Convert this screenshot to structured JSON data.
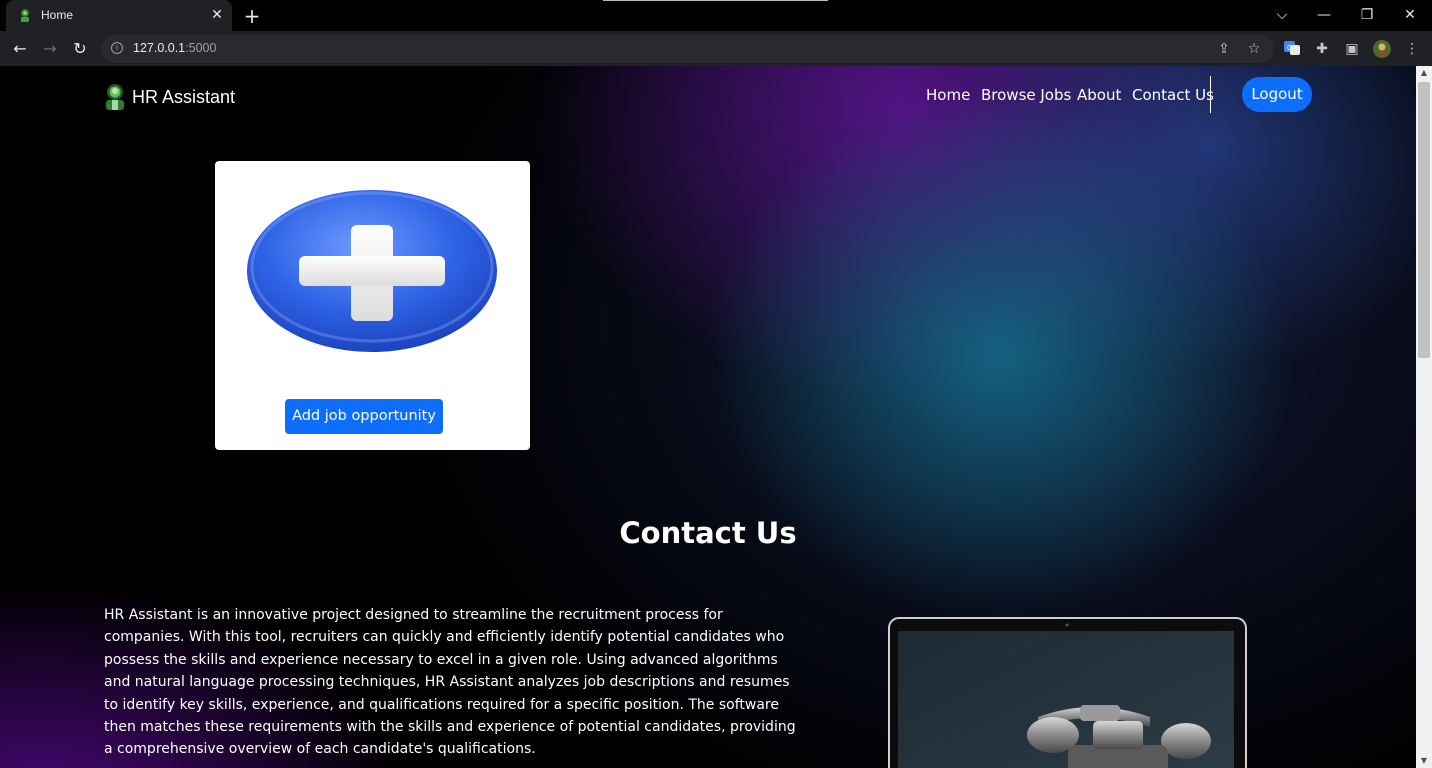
{
  "browser": {
    "tab_title": "Home",
    "url_host": "127.0.0.1",
    "url_port": ":5000"
  },
  "navbar": {
    "brand": "HR Assistant",
    "links": [
      "Home",
      "Browse Jobs",
      "About",
      "Contact Us"
    ],
    "logout_label": "Logout"
  },
  "card": {
    "image": "plus-icon",
    "button_label": "Add job opportunity"
  },
  "contact": {
    "title": "Contact Us",
    "paragraph": "HR Assistant is an innovative project designed to streamline the recruitment process for companies. With this tool, recruiters can quickly and efficiently identify potential candidates who possess the skills and experience necessary to excel in a given role. Using advanced algorithms and natural language processing techniques, HR Assistant analyzes job descriptions and resumes to identify key skills, experience, and qualifications required for a specific position. The software then matches these requirements with the skills and experience of potential candidates, providing a comprehensive overview of each candidate's qualifications.",
    "image": "laptop-telephone-image"
  },
  "colors": {
    "primary": "#0d6efd",
    "chrome_bg": "#202124",
    "page_bg": "#000000"
  }
}
